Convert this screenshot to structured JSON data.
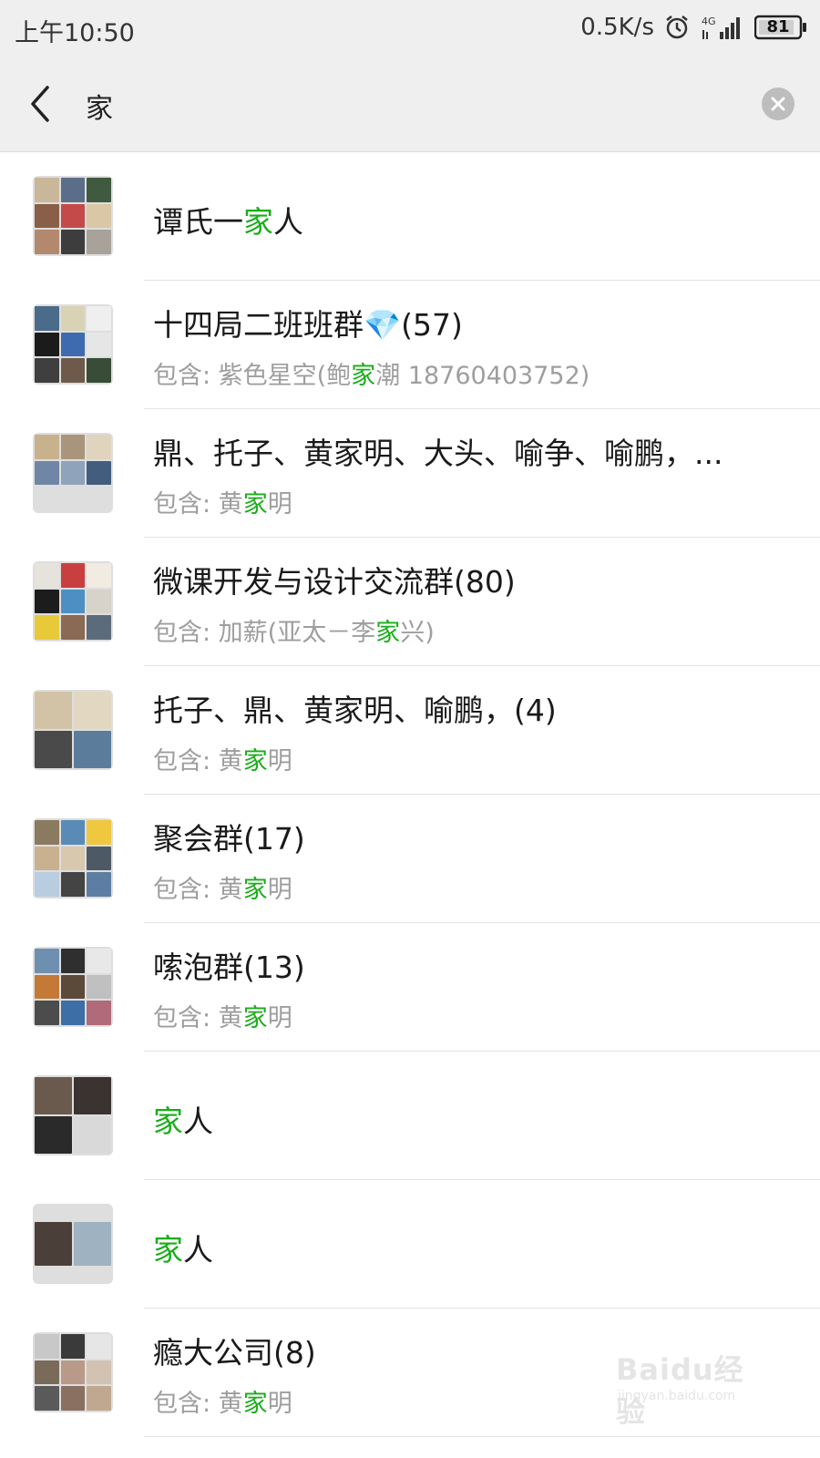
{
  "status_bar": {
    "time": "上午10:50",
    "speed": "0.5K/s",
    "network": "4G",
    "battery": "81"
  },
  "search": {
    "query": "家"
  },
  "colors": {
    "highlight": "#1aad19",
    "background": "#efefef"
  },
  "results": [
    {
      "title_parts": [
        "谭氏一",
        "家",
        "人"
      ],
      "subtitle_parts": null,
      "avatar": [
        "#c9b79a",
        "#5a6e8a",
        "#3f5a3e",
        "#8a5f47",
        "#c44a4a",
        "#d9c7a6",
        "#b3896e",
        "#3d3d3d",
        "#a9a29a"
      ]
    },
    {
      "title_parts": [
        "十四局二班班群",
        "",
        "💎(57)"
      ],
      "subtitle_parts": [
        "包含: 紫色星空(鲍",
        "家",
        "潮 18760403752)"
      ],
      "avatar": [
        "#4b6b8a",
        "#d8d3b4",
        "#efefef",
        "#1b1b1b",
        "#3e6ab0",
        "#e6e6e6",
        "#3f3f3f",
        "#6d5a4a",
        "#384c38"
      ]
    },
    {
      "title_parts": [
        "鼎、托子、黄家明、大头、喻争、喻鹏，...",
        "",
        ""
      ],
      "subtitle_parts": [
        "包含: 黄",
        "家",
        "明"
      ],
      "avatar": [
        "#c8b18d",
        "#a9957c",
        "#e0d4be",
        "#6f86a6",
        "#8fa3ba",
        "#435d7e"
      ]
    },
    {
      "title_parts": [
        "微课开发与设计交流群(80)",
        "",
        ""
      ],
      "subtitle_parts": [
        "包含: 加薪(亚太－李",
        "家",
        "兴)"
      ],
      "avatar": [
        "#e6e2dc",
        "#c93f3f",
        "#f1ebe2",
        "#1c1c1c",
        "#4d8fc2",
        "#d7d2ca",
        "#e7c93a",
        "#8a6a55",
        "#5b6b7a"
      ]
    },
    {
      "title_parts": [
        "托子、鼎、黄家明、喻鹏，(4)",
        "",
        ""
      ],
      "subtitle_parts": [
        "包含: 黄",
        "家",
        "明"
      ],
      "avatar": [
        "#d3c3a6",
        "#e2d8c2",
        "#4a4a4a",
        "#5c7c9c"
      ]
    },
    {
      "title_parts": [
        "聚会群(17)",
        "",
        ""
      ],
      "subtitle_parts": [
        "包含: 黄",
        "家",
        "明"
      ],
      "avatar": [
        "#8a7a60",
        "#5a8ab6",
        "#f0c840",
        "#c9b18f",
        "#d8c9ae",
        "#4d5a66",
        "#b9cde0",
        "#444444",
        "#5d7ea2"
      ]
    },
    {
      "title_parts": [
        "嗦泡群(13)",
        "",
        ""
      ],
      "subtitle_parts": [
        "包含: 黄",
        "家",
        "明"
      ],
      "avatar": [
        "#6f8fb0",
        "#2f2f2f",
        "#e8e8e8",
        "#c47a36",
        "#5b4a3a",
        "#c0c0c0",
        "#4c4c4c",
        "#3d6ea6",
        "#b06a7a"
      ]
    },
    {
      "title_parts": [
        "",
        "家",
        "人"
      ],
      "subtitle_parts": null,
      "avatar": [
        "#6a5a4e",
        "#3a3330",
        "#2a2a2a",
        "#d9d9d9"
      ]
    },
    {
      "title_parts": [
        "",
        "家",
        "人"
      ],
      "subtitle_parts": null,
      "avatar": [
        "#4b3f3a",
        "#9fb2c2"
      ],
      "avatar_layout": "two"
    },
    {
      "title_parts": [
        "瘾大公司(8)",
        "",
        ""
      ],
      "subtitle_parts": [
        "包含: 黄",
        "家",
        "明"
      ],
      "avatar": [
        "#c8c8c8",
        "#3a3a3a",
        "#e6e6e6",
        "#7a6a5a",
        "#b99a88",
        "#d2c2b2",
        "#5a5a5a",
        "#8a7060",
        "#c0a890"
      ]
    }
  ],
  "watermark": {
    "logo": "Baidu经验",
    "url": "jingyan.baidu.com"
  }
}
